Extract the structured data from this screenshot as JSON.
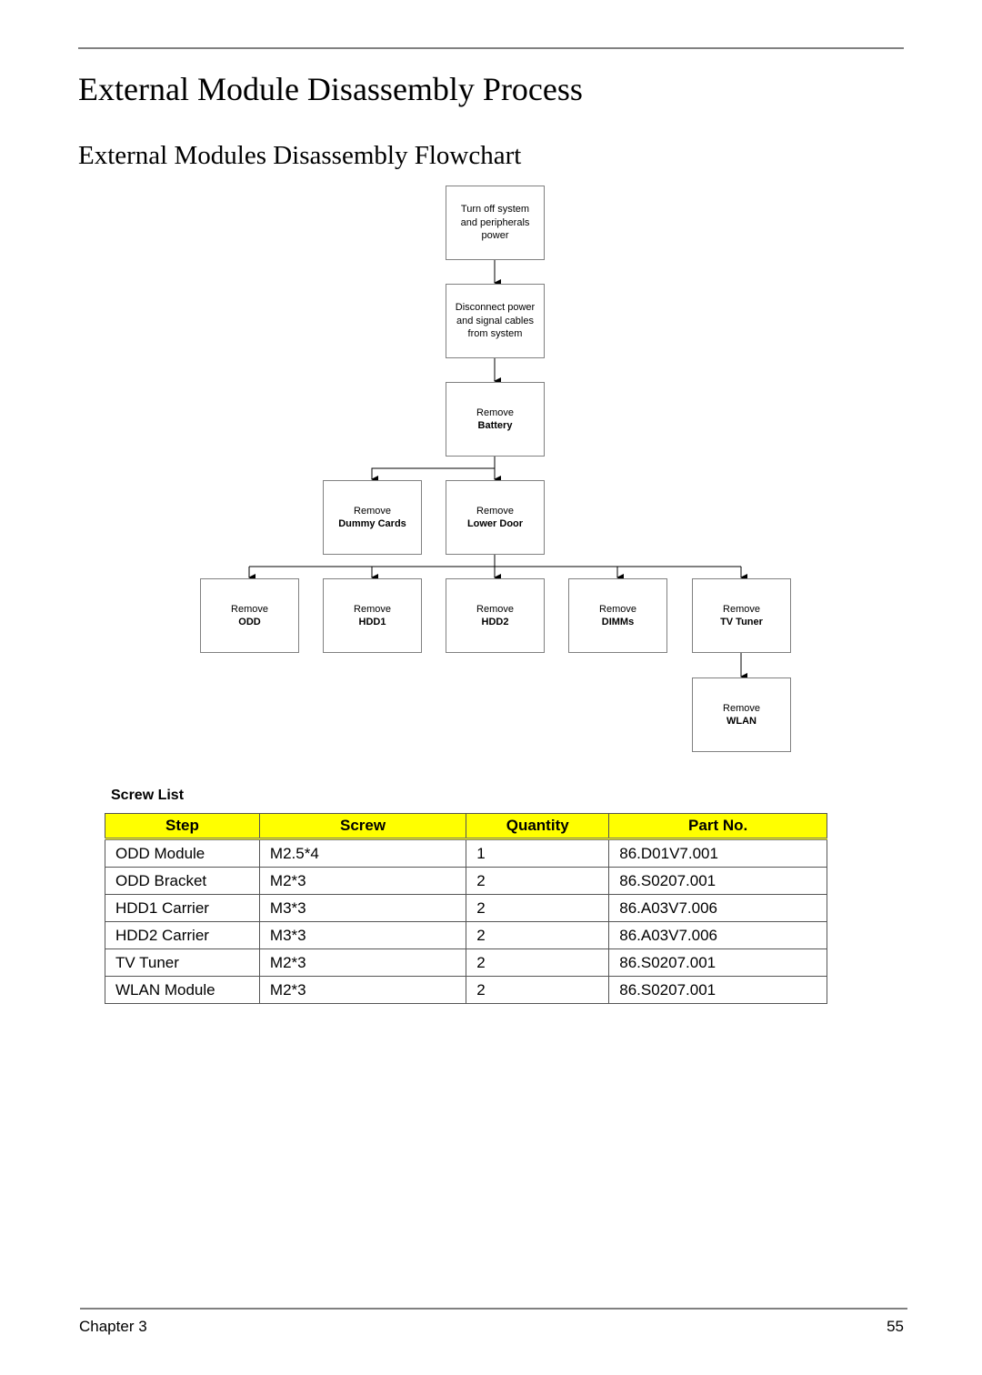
{
  "page": {
    "title": "External Module Disassembly Process",
    "subtitle": "External Modules Disassembly Flowchart"
  },
  "flowchart": {
    "nodes": {
      "turn_off": {
        "text": "Turn off system\nand peripherals\npower"
      },
      "disconnect": {
        "text": "Disconnect power\nand signal cables\nfrom system"
      },
      "battery": {
        "action": "Remove",
        "item": "Battery"
      },
      "dummy_cards": {
        "action": "Remove",
        "item": "Dummy Cards"
      },
      "lower_door": {
        "action": "Remove",
        "item": "Lower Door"
      },
      "odd": {
        "action": "Remove",
        "item": "ODD"
      },
      "hdd1": {
        "action": "Remove",
        "item": "HDD1"
      },
      "hdd2": {
        "action": "Remove",
        "item": "HDD2"
      },
      "dimms": {
        "action": "Remove",
        "item": "DIMMs"
      },
      "tv_tuner": {
        "action": "Remove",
        "item": "TV Tuner"
      },
      "wlan": {
        "action": "Remove",
        "item": "WLAN"
      }
    },
    "edges": [
      [
        "turn_off",
        "disconnect"
      ],
      [
        "disconnect",
        "battery"
      ],
      [
        "battery",
        "dummy_cards"
      ],
      [
        "battery",
        "lower_door"
      ],
      [
        "lower_door",
        "odd"
      ],
      [
        "lower_door",
        "hdd1"
      ],
      [
        "lower_door",
        "hdd2"
      ],
      [
        "lower_door",
        "dimms"
      ],
      [
        "lower_door",
        "tv_tuner"
      ],
      [
        "tv_tuner",
        "wlan"
      ]
    ]
  },
  "screw_list": {
    "title": "Screw List",
    "headers": [
      "Step",
      "Screw",
      "Quantity",
      "Part No."
    ],
    "header_color": "#ffff00",
    "rows": [
      [
        "ODD Module",
        "M2.5*4",
        "1",
        "86.D01V7.001"
      ],
      [
        "ODD Bracket",
        "M2*3",
        "2",
        "86.S0207.001"
      ],
      [
        "HDD1 Carrier",
        "M3*3",
        "2",
        "86.A03V7.006"
      ],
      [
        "HDD2 Carrier",
        "M3*3",
        "2",
        "86.A03V7.006"
      ],
      [
        "TV Tuner",
        "M2*3",
        "2",
        "86.S0207.001"
      ],
      [
        "WLAN Module",
        "M2*3",
        "2",
        "86.S0207.001"
      ]
    ]
  },
  "footer": {
    "chapter": "Chapter 3",
    "page_number": "55"
  }
}
